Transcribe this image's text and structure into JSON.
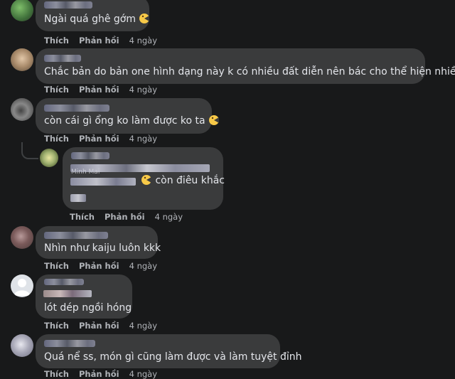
{
  "actions": {
    "like": "Thích",
    "reply": "Phản hồi"
  },
  "comments": [
    {
      "text": "Ngài quá ghê gớm",
      "time": "4 ngày",
      "emoji": "laughing-emoji"
    },
    {
      "text": "Chắc bản do bản one hình dạng này k có nhiều đất diễn nên bác cho thể hiện nhiều",
      "time": "4 ngày"
    },
    {
      "text": "còn cái gì ổng ko làm được ko ta",
      "time": "4 ngày",
      "emoji": "laughing-emoji"
    },
    {
      "text": "còn điêu khắc",
      "time": "4 ngày",
      "emoji": "laughing-emoji",
      "reply_to": 2
    },
    {
      "text": "Nhìn như kaiju luôn kkk",
      "time": "4 ngày"
    },
    {
      "text": "lót dép ngồi hóng",
      "time": "4 ngày"
    },
    {
      "text": "Quá nể ss, món gì cũng làm được và làm tuyệt đỉnh",
      "time": "4 ngày"
    }
  ],
  "partial_name": "Minh Mai",
  "colors": {
    "background": "#18191a",
    "bubble": "#3a3b3c",
    "text": "#e4e6eb",
    "secondary": "#b0b3b8"
  }
}
